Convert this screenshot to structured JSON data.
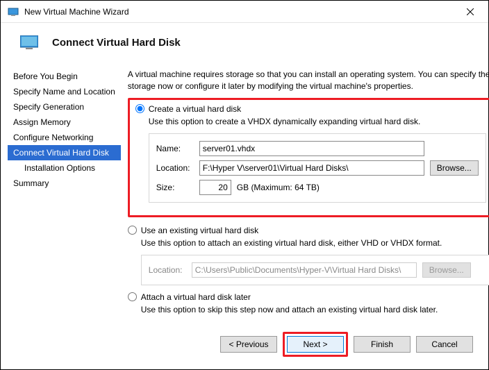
{
  "titlebar": {
    "title": "New Virtual Machine Wizard"
  },
  "header": {
    "title": "Connect Virtual Hard Disk"
  },
  "sidebar": {
    "items": [
      {
        "label": "Before You Begin"
      },
      {
        "label": "Specify Name and Location"
      },
      {
        "label": "Specify Generation"
      },
      {
        "label": "Assign Memory"
      },
      {
        "label": "Configure Networking"
      },
      {
        "label": "Connect Virtual Hard Disk"
      },
      {
        "label": "Installation Options"
      },
      {
        "label": "Summary"
      }
    ]
  },
  "main": {
    "intro": "A virtual machine requires storage so that you can install an operating system. You can specify the storage now or configure it later by modifying the virtual machine's properties.",
    "opt1": {
      "label": "Create a virtual hard disk",
      "desc": "Use this option to create a VHDX dynamically expanding virtual hard disk.",
      "name_label": "Name:",
      "name_value": "server01.vhdx",
      "loc_label": "Location:",
      "loc_value": "F:\\Hyper V\\server01\\Virtual Hard Disks\\",
      "browse": "Browse...",
      "size_label": "Size:",
      "size_value": "20",
      "size_hint": "GB (Maximum: 64 TB)"
    },
    "opt2": {
      "label": "Use an existing virtual hard disk",
      "desc": "Use this option to attach an existing virtual hard disk, either VHD or VHDX format.",
      "loc_label": "Location:",
      "loc_value": "C:\\Users\\Public\\Documents\\Hyper-V\\Virtual Hard Disks\\",
      "browse": "Browse..."
    },
    "opt3": {
      "label": "Attach a virtual hard disk later",
      "desc": "Use this option to skip this step now and attach an existing virtual hard disk later."
    }
  },
  "buttons": {
    "previous": "< Previous",
    "next": "Next >",
    "finish": "Finish",
    "cancel": "Cancel"
  }
}
